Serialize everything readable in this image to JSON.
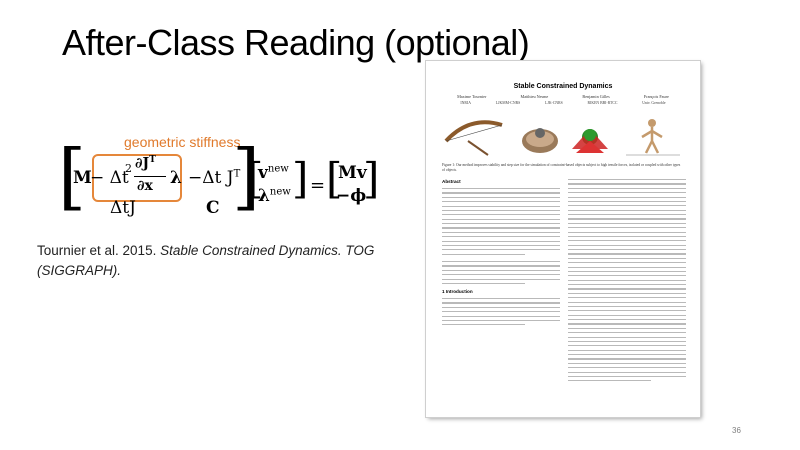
{
  "slide": {
    "title": "After-Class Reading (optional)",
    "annotation_label": "geometric stiffness",
    "equation": {
      "row1_m": "M",
      "row1_minus": "− Δt",
      "row1_sq": "2",
      "row1_partial_top": "∂J",
      "row1_T": "T",
      "row1_partial_bottom": "∂x",
      "row1_lambda": "λ",
      "row1_minus2": "−Δt J",
      "row1_T2": "T",
      "row2_dtj": "ΔtJ",
      "row2_c": "C",
      "vec_v": "v",
      "vec_v_sup": "new",
      "vec_l": "λ",
      "vec_l_sup": "new",
      "equals": "=",
      "rhs_1": "Mv",
      "rhs_2": "−ϕ"
    },
    "citation_plain": "Tournier et al. 2015. ",
    "citation_italic": "Stable Constrained Dynamics. TOG (SIGGRAPH).",
    "page_number": "36"
  },
  "paper": {
    "title": "Stable Constrained Dynamics",
    "authors": [
      "Maxime Tournier",
      "Matthieu Nesme",
      "Benjamin Gilles",
      "François Faure"
    ],
    "affiliations": [
      "INRIA",
      "LJKMM-CNRS",
      "LJK-CNRS",
      "RIKEN BBI-RTCC",
      "Univ. Grenoble"
    ],
    "caption": "Figure 1: Our method improves stability and step size for the simulation of constraint-based objects subject to high tensile forces, isolated or coupled with other types of objects.",
    "abstract_heading": "Abstract",
    "intro_heading": "1   Introduction"
  }
}
